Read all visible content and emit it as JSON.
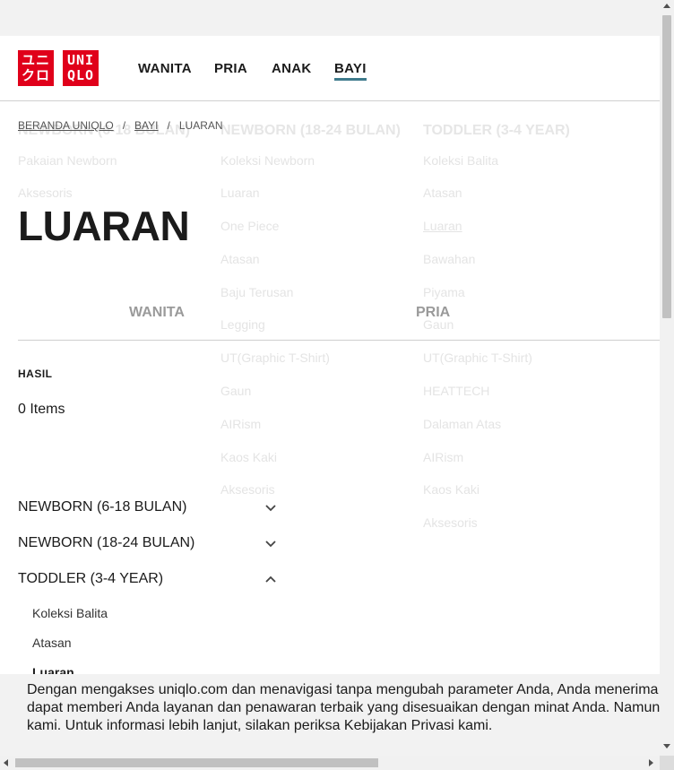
{
  "header": {
    "logo_jp_line1": "ユニ",
    "logo_jp_line2": "クロ",
    "logo_en_line1": "UNI",
    "logo_en_line2": "QLO",
    "nav": [
      "WANITA",
      "PRIA",
      "ANAK",
      "BAYI"
    ],
    "active_nav": "BAYI",
    "accent_color": "#3e7a8c",
    "brand_color": "#e0001a"
  },
  "ghost_menu": {
    "col1": {
      "heading": "NEWBORN (6-18 BULAN)",
      "items": [
        "Pakaian Newborn",
        "Aksesoris"
      ]
    },
    "col2": {
      "heading": "NEWBORN (18-24 BULAN)",
      "items": [
        "Koleksi Newborn",
        "Luaran",
        "One Piece",
        "Atasan",
        "Baju Terusan",
        "Legging",
        "UT(Graphic T-Shirt)",
        "Gaun",
        "AIRism",
        "Kaos Kaki",
        "Aksesoris"
      ]
    },
    "col3": {
      "heading": "TODDLER (3-4 YEAR)",
      "items": [
        "Koleksi Balita",
        "Atasan",
        "Luaran",
        "Bawahan",
        "Piyama",
        "Gaun",
        "UT(Graphic T-Shirt)",
        "HEATTECH",
        "Dalaman Atas",
        "AIRism",
        "Kaos Kaki",
        "Aksesoris"
      ]
    }
  },
  "breadcrumb": {
    "home": "BERANDA UNIQLO",
    "section": "BAYI",
    "current": "LUARAN",
    "separator": "/"
  },
  "page_title": "LUARAN",
  "gender_tabs": [
    "WANITA",
    "PRIA"
  ],
  "results": {
    "label": "HASIL",
    "count": "0 Items"
  },
  "categories": [
    {
      "label": "NEWBORN (6-18 BULAN)",
      "expanded": false
    },
    {
      "label": "NEWBORN (18-24 BULAN)",
      "expanded": false
    },
    {
      "label": "TODDLER (3-4 YEAR)",
      "expanded": true
    }
  ],
  "toddler_items": [
    "Koleksi Balita",
    "Atasan",
    "Luaran"
  ],
  "cookie": {
    "line1": "Dengan mengakses uniqlo.com dan menavigasi tanpa mengubah parameter Anda, Anda menerima",
    "line2": "dapat memberi Anda layanan dan penawaran terbaik yang disesuaikan dengan minat Anda. Namun",
    "line3": "kami. Untuk informasi lebih lanjut, silakan periksa Kebijakan Privasi kami."
  }
}
